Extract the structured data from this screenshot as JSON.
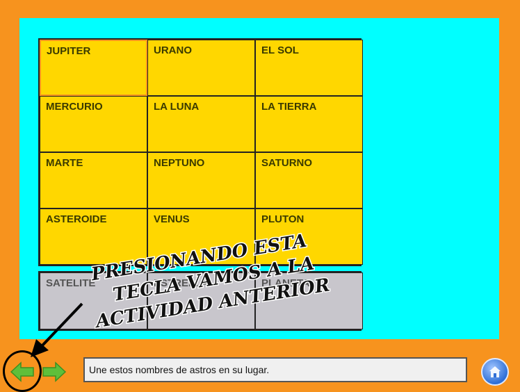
{
  "board": {
    "cells": [
      [
        "JUPITER",
        "URANO",
        "EL SOL"
      ],
      [
        "MERCURIO",
        "LA LUNA",
        "LA TIERRA"
      ],
      [
        "MARTE",
        "NEPTUNO",
        "SATURNO"
      ],
      [
        "ASTEROIDE",
        "VENUS",
        "PLUTON"
      ]
    ]
  },
  "tray": {
    "items": [
      "SATELITE",
      "ESTRELLA",
      "PLANETA"
    ]
  },
  "annotation": {
    "lines": [
      "PRESIONANDO ESTA",
      "TECLA VAMOS A LA",
      "ACTIVIDAD ANTERIOR"
    ]
  },
  "status_bar": {
    "message": "Une estos nombres de astros en su lugar."
  },
  "icons": {
    "prev": "arrow-left-icon",
    "next": "arrow-right-icon",
    "home": "home-icon"
  },
  "colors": {
    "background": "#f7931e",
    "stage": "#00ffff",
    "cell": "#ffd700",
    "tray": "#c8c6cc",
    "arrow_green": "#5fbf3a"
  }
}
